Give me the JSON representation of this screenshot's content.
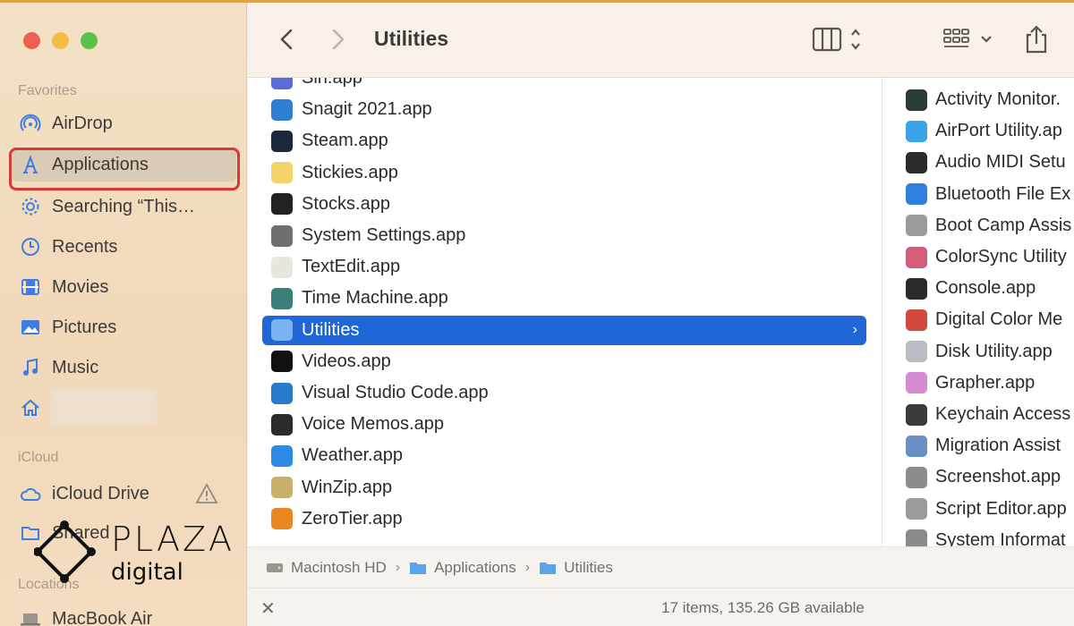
{
  "window": {
    "title": "Utilities"
  },
  "sidebar": {
    "favorites_label": "Favorites",
    "favorites": [
      {
        "label": "AirDrop",
        "icon": "airdrop-icon"
      },
      {
        "label": "Applications",
        "icon": "applications-icon",
        "selected": true
      },
      {
        "label": "Searching “This…",
        "icon": "gear-icon"
      },
      {
        "label": "Recents",
        "icon": "clock-icon"
      },
      {
        "label": "Movies",
        "icon": "film-icon"
      },
      {
        "label": "Pictures",
        "icon": "photo-icon"
      },
      {
        "label": "Music",
        "icon": "music-note-icon"
      },
      {
        "label": "",
        "icon": "home-icon"
      }
    ],
    "icloud_label": "iCloud",
    "icloud": [
      {
        "label": "iCloud Drive",
        "icon": "cloud-icon"
      },
      {
        "label": "Shared",
        "icon": "shared-folder-icon"
      }
    ],
    "locations_label": "Locations",
    "locations": [
      {
        "label": "MacBook Air",
        "icon": "laptop-icon"
      }
    ]
  },
  "toolbar": {
    "title": "Utilities",
    "back": "back-chevron-icon",
    "forward": "forward-chevron-icon",
    "view": "column-view-icon",
    "group": "grid-group-icon",
    "share": "share-icon"
  },
  "applications_column": [
    {
      "name": "Siri.app",
      "color": "#5b6bd6"
    },
    {
      "name": "Snagit 2021.app",
      "color": "#2f7fd1"
    },
    {
      "name": "Steam.app",
      "color": "#1b2838"
    },
    {
      "name": "Stickies.app",
      "color": "#f3d36b"
    },
    {
      "name": "Stocks.app",
      "color": "#222222"
    },
    {
      "name": "System Settings.app",
      "color": "#6f6f6f"
    },
    {
      "name": "TextEdit.app",
      "color": "#e9e6e0"
    },
    {
      "name": "Time Machine.app",
      "color": "#3a7f7a"
    },
    {
      "name": "Utilities",
      "color": "#79b4f0",
      "selected": true
    },
    {
      "name": "Videos.app",
      "color": "#111111"
    },
    {
      "name": "Visual Studio Code.app",
      "color": "#2a7acc"
    },
    {
      "name": "Voice Memos.app",
      "color": "#2b2b2b"
    },
    {
      "name": "Weather.app",
      "color": "#2f8ae3"
    },
    {
      "name": "WinZip.app",
      "color": "#c9b06a"
    },
    {
      "name": "ZeroTier.app",
      "color": "#e8861f"
    }
  ],
  "utilities_column": [
    {
      "name": "Activity Monitor.",
      "color": "#2c3a3a"
    },
    {
      "name": "AirPort Utility.ap",
      "color": "#3ba3e8"
    },
    {
      "name": "Audio MIDI Setu",
      "color": "#2b2b2b"
    },
    {
      "name": "Bluetooth File Ex",
      "color": "#2f7fe0"
    },
    {
      "name": "Boot Camp Assis",
      "color": "#9a9a9a"
    },
    {
      "name": "ColorSync Utility",
      "color": "#d35e7a"
    },
    {
      "name": "Console.app",
      "color": "#2b2b2b"
    },
    {
      "name": "Digital Color Me",
      "color": "#d0493b"
    },
    {
      "name": "Disk Utility.app",
      "color": "#b9bcc2"
    },
    {
      "name": "Grapher.app",
      "color": "#d48bd0"
    },
    {
      "name": "Keychain Access",
      "color": "#3a3a3a"
    },
    {
      "name": "Migration Assist",
      "color": "#6b8fc4"
    },
    {
      "name": "Screenshot.app",
      "color": "#8c8c8c"
    },
    {
      "name": "Script Editor.app",
      "color": "#9a9a9a"
    },
    {
      "name": "System Informat",
      "color": "#8a8a8a"
    }
  ],
  "pathbar": {
    "crumbs": [
      "Macintosh HD",
      "Applications",
      "Utilities"
    ]
  },
  "status": {
    "text": "17 items, 135.26 GB available"
  },
  "watermark": {
    "line1": "PLAZA",
    "line2": "digital"
  }
}
